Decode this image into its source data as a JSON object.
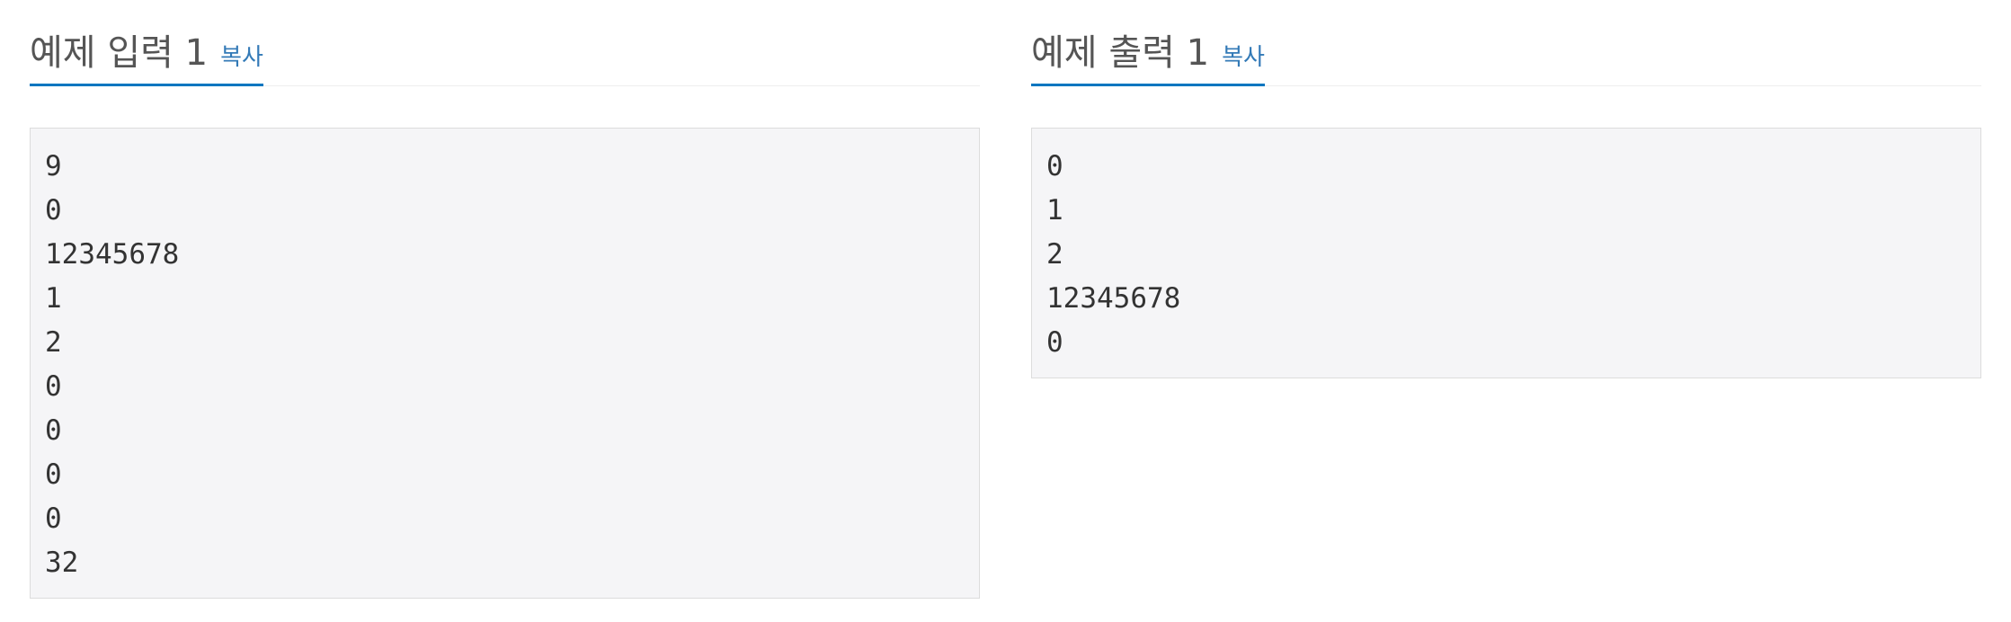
{
  "input": {
    "title": "예제 입력 1",
    "copy_label": "복사",
    "lines": [
      "9",
      "0",
      "12345678",
      "1",
      "2",
      "0",
      "0",
      "0",
      "0",
      "32"
    ]
  },
  "output": {
    "title": "예제 출력 1",
    "copy_label": "복사",
    "lines": [
      "0",
      "1",
      "2",
      "12345678",
      "0"
    ]
  },
  "colors": {
    "accent": "#0076c0",
    "link": "#337ab7",
    "box_bg": "#f5f5f7",
    "box_border": "#dcdcdc"
  }
}
